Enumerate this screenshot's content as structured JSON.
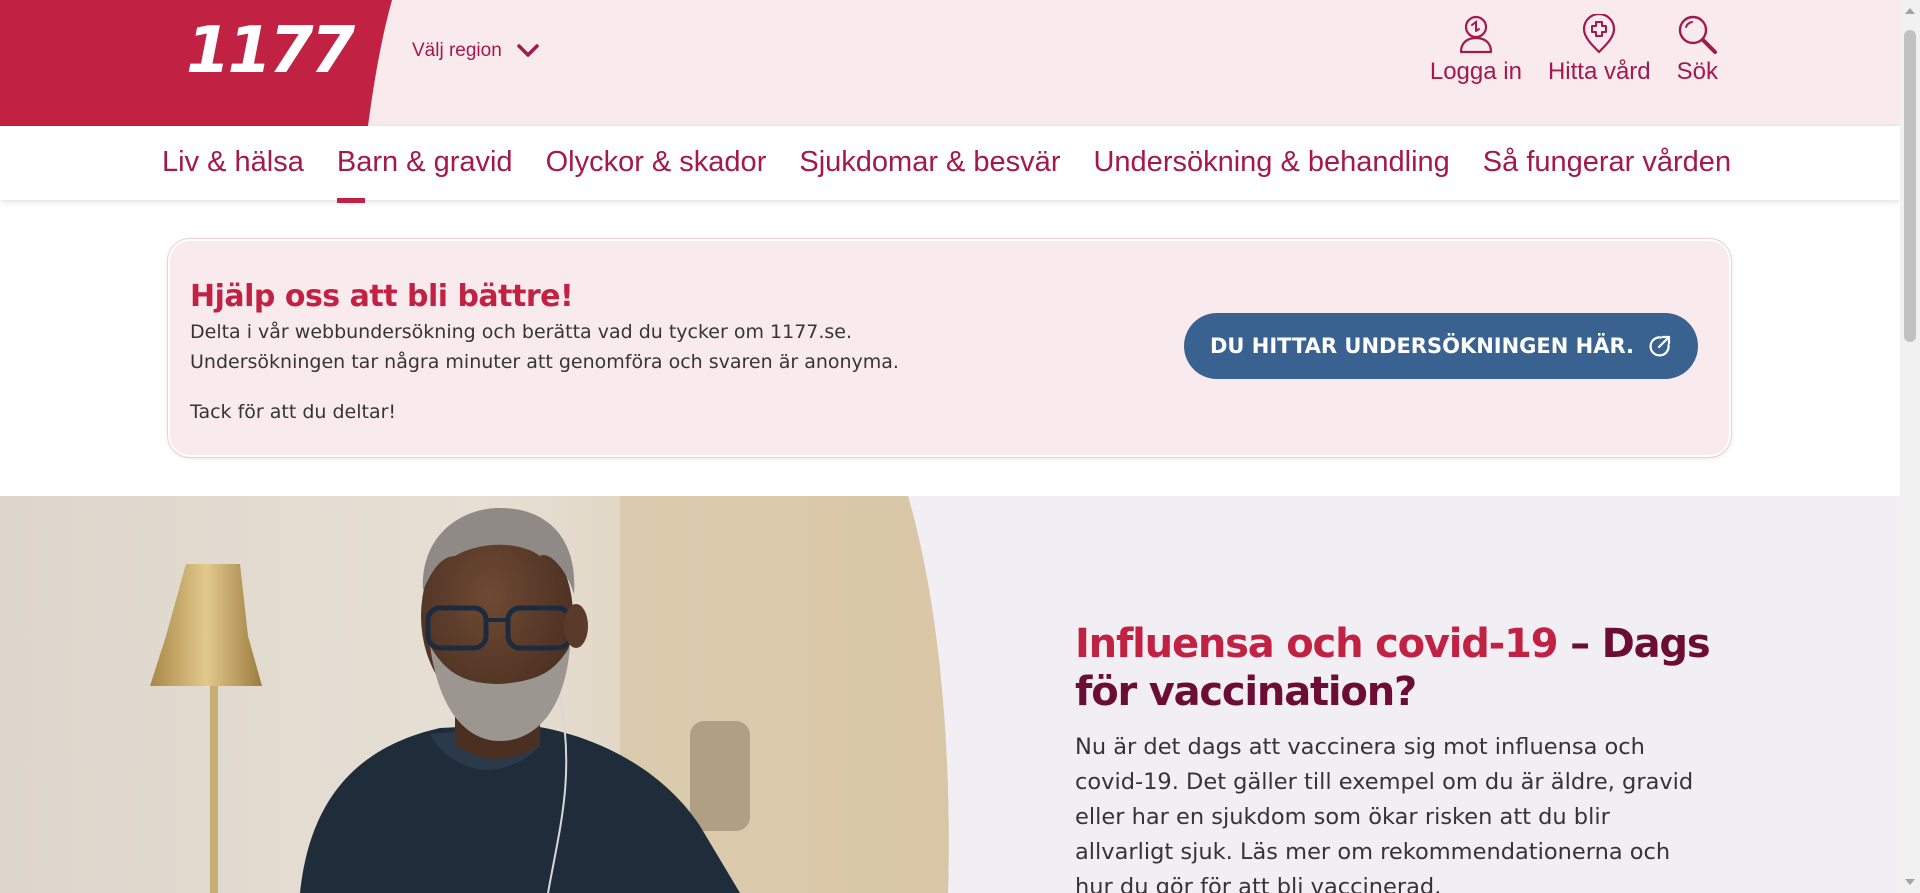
{
  "header": {
    "logo_text": "1177",
    "region_label": "Välj region",
    "actions": [
      {
        "label": "Logga in",
        "icon": "user-icon"
      },
      {
        "label": "Hitta vård",
        "icon": "map-pin-cross-icon"
      },
      {
        "label": "Sök",
        "icon": "search-icon"
      }
    ]
  },
  "nav": {
    "items": [
      {
        "label": "Liv & hälsa"
      },
      {
        "label": "Barn & gravid",
        "active": true
      },
      {
        "label": "Olyckor & skador"
      },
      {
        "label": "Sjukdomar & besvär"
      },
      {
        "label": "Undersökning & behandling"
      },
      {
        "label": "Så fungerar vården"
      }
    ]
  },
  "survey": {
    "title": "Hjälp oss att bli bättre!",
    "text": "Delta i vår webbundersökning och berätta vad du tycker om 1177.se. Undersökningen tar några minuter att genomföra och svaren är anonyma.",
    "thanks": "Tack för att du deltar!",
    "button_label": "DU HITTAR UNDERSÖKNINGEN HÄR.",
    "button_icon": "external-link-icon"
  },
  "hero": {
    "title_accent": "Influensa och covid-19",
    "title_rest": " – Dags för vaccination?",
    "text": "Nu är det dags att vaccinera sig mot influensa och covid-19. Det gäller till exempel om du är äldre, gravid eller har en sjukdom som ökar risken att du blir allvarligt sjuk. Läs mer om rekommendationerna och hur du gör för att bli vaccinerad."
  },
  "colors": {
    "brand": "#c12143",
    "brand_dark": "#6b0d35",
    "link": "#a4184b",
    "header_bg": "#f9ebed",
    "button": "#396291",
    "hero_bg": "#f1eff4"
  }
}
